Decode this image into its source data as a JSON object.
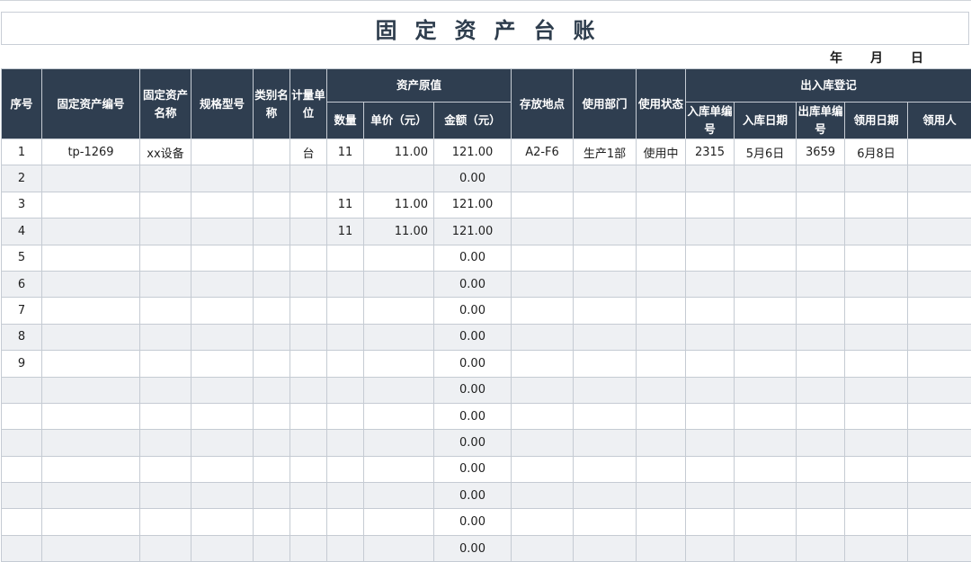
{
  "title": "固定资产台账",
  "date_labels": {
    "year": "年",
    "month": "月",
    "day": "日"
  },
  "headers": {
    "seq": "序号",
    "asset_no": "固定资产编号",
    "asset_name": "固定资产名称",
    "spec": "规格型号",
    "category": "类别名称",
    "unit": "计量单位",
    "original_value": "资产原值",
    "qty": "数量",
    "price": "单价（元）",
    "amount": "金额（元）",
    "location": "存放地点",
    "dept": "使用部门",
    "status": "使用状态",
    "inout": "出入库登记",
    "in_no": "入库单编号",
    "in_date": "入库日期",
    "out_no": "出库单编号",
    "use_date": "领用日期",
    "user": "领用人"
  },
  "rows": [
    {
      "seq": "1",
      "asset_no": "tp-1269",
      "asset_name": "xx设备",
      "spec": "",
      "category": "",
      "unit": "台",
      "qty": "11",
      "price": "11.00",
      "amount": "121.00",
      "location": "A2-F6",
      "dept": "生产1部",
      "status": "使用中",
      "in_no": "2315",
      "in_date": "5月6日",
      "out_no": "3659",
      "use_date": "6月8日",
      "user": ""
    },
    {
      "seq": "2",
      "asset_no": "",
      "asset_name": "",
      "spec": "",
      "category": "",
      "unit": "",
      "qty": "",
      "price": "",
      "amount": "0.00",
      "location": "",
      "dept": "",
      "status": "",
      "in_no": "",
      "in_date": "",
      "out_no": "",
      "use_date": "",
      "user": ""
    },
    {
      "seq": "3",
      "asset_no": "",
      "asset_name": "",
      "spec": "",
      "category": "",
      "unit": "",
      "qty": "11",
      "price": "11.00",
      "amount": "121.00",
      "location": "",
      "dept": "",
      "status": "",
      "in_no": "",
      "in_date": "",
      "out_no": "",
      "use_date": "",
      "user": ""
    },
    {
      "seq": "4",
      "asset_no": "",
      "asset_name": "",
      "spec": "",
      "category": "",
      "unit": "",
      "qty": "11",
      "price": "11.00",
      "amount": "121.00",
      "location": "",
      "dept": "",
      "status": "",
      "in_no": "",
      "in_date": "",
      "out_no": "",
      "use_date": "",
      "user": ""
    },
    {
      "seq": "5",
      "asset_no": "",
      "asset_name": "",
      "spec": "",
      "category": "",
      "unit": "",
      "qty": "",
      "price": "",
      "amount": "0.00",
      "location": "",
      "dept": "",
      "status": "",
      "in_no": "",
      "in_date": "",
      "out_no": "",
      "use_date": "",
      "user": ""
    },
    {
      "seq": "6",
      "asset_no": "",
      "asset_name": "",
      "spec": "",
      "category": "",
      "unit": "",
      "qty": "",
      "price": "",
      "amount": "0.00",
      "location": "",
      "dept": "",
      "status": "",
      "in_no": "",
      "in_date": "",
      "out_no": "",
      "use_date": "",
      "user": ""
    },
    {
      "seq": "7",
      "asset_no": "",
      "asset_name": "",
      "spec": "",
      "category": "",
      "unit": "",
      "qty": "",
      "price": "",
      "amount": "0.00",
      "location": "",
      "dept": "",
      "status": "",
      "in_no": "",
      "in_date": "",
      "out_no": "",
      "use_date": "",
      "user": ""
    },
    {
      "seq": "8",
      "asset_no": "",
      "asset_name": "",
      "spec": "",
      "category": "",
      "unit": "",
      "qty": "",
      "price": "",
      "amount": "0.00",
      "location": "",
      "dept": "",
      "status": "",
      "in_no": "",
      "in_date": "",
      "out_no": "",
      "use_date": "",
      "user": ""
    },
    {
      "seq": "9",
      "asset_no": "",
      "asset_name": "",
      "spec": "",
      "category": "",
      "unit": "",
      "qty": "",
      "price": "",
      "amount": "0.00",
      "location": "",
      "dept": "",
      "status": "",
      "in_no": "",
      "in_date": "",
      "out_no": "",
      "use_date": "",
      "user": ""
    },
    {
      "seq": "",
      "asset_no": "",
      "asset_name": "",
      "spec": "",
      "category": "",
      "unit": "",
      "qty": "",
      "price": "",
      "amount": "0.00",
      "location": "",
      "dept": "",
      "status": "",
      "in_no": "",
      "in_date": "",
      "out_no": "",
      "use_date": "",
      "user": ""
    },
    {
      "seq": "",
      "asset_no": "",
      "asset_name": "",
      "spec": "",
      "category": "",
      "unit": "",
      "qty": "",
      "price": "",
      "amount": "0.00",
      "location": "",
      "dept": "",
      "status": "",
      "in_no": "",
      "in_date": "",
      "out_no": "",
      "use_date": "",
      "user": ""
    },
    {
      "seq": "",
      "asset_no": "",
      "asset_name": "",
      "spec": "",
      "category": "",
      "unit": "",
      "qty": "",
      "price": "",
      "amount": "0.00",
      "location": "",
      "dept": "",
      "status": "",
      "in_no": "",
      "in_date": "",
      "out_no": "",
      "use_date": "",
      "user": ""
    },
    {
      "seq": "",
      "asset_no": "",
      "asset_name": "",
      "spec": "",
      "category": "",
      "unit": "",
      "qty": "",
      "price": "",
      "amount": "0.00",
      "location": "",
      "dept": "",
      "status": "",
      "in_no": "",
      "in_date": "",
      "out_no": "",
      "use_date": "",
      "user": ""
    },
    {
      "seq": "",
      "asset_no": "",
      "asset_name": "",
      "spec": "",
      "category": "",
      "unit": "",
      "qty": "",
      "price": "",
      "amount": "0.00",
      "location": "",
      "dept": "",
      "status": "",
      "in_no": "",
      "in_date": "",
      "out_no": "",
      "use_date": "",
      "user": ""
    },
    {
      "seq": "",
      "asset_no": "",
      "asset_name": "",
      "spec": "",
      "category": "",
      "unit": "",
      "qty": "",
      "price": "",
      "amount": "0.00",
      "location": "",
      "dept": "",
      "status": "",
      "in_no": "",
      "in_date": "",
      "out_no": "",
      "use_date": "",
      "user": ""
    },
    {
      "seq": "",
      "asset_no": "",
      "asset_name": "",
      "spec": "",
      "category": "",
      "unit": "",
      "qty": "",
      "price": "",
      "amount": "0.00",
      "location": "",
      "dept": "",
      "status": "",
      "in_no": "",
      "in_date": "",
      "out_no": "",
      "use_date": "",
      "user": ""
    }
  ],
  "colors": {
    "header_bg": "#2f3e50",
    "title_color": "#2e3d4d",
    "stripe": "#eef0f3"
  }
}
